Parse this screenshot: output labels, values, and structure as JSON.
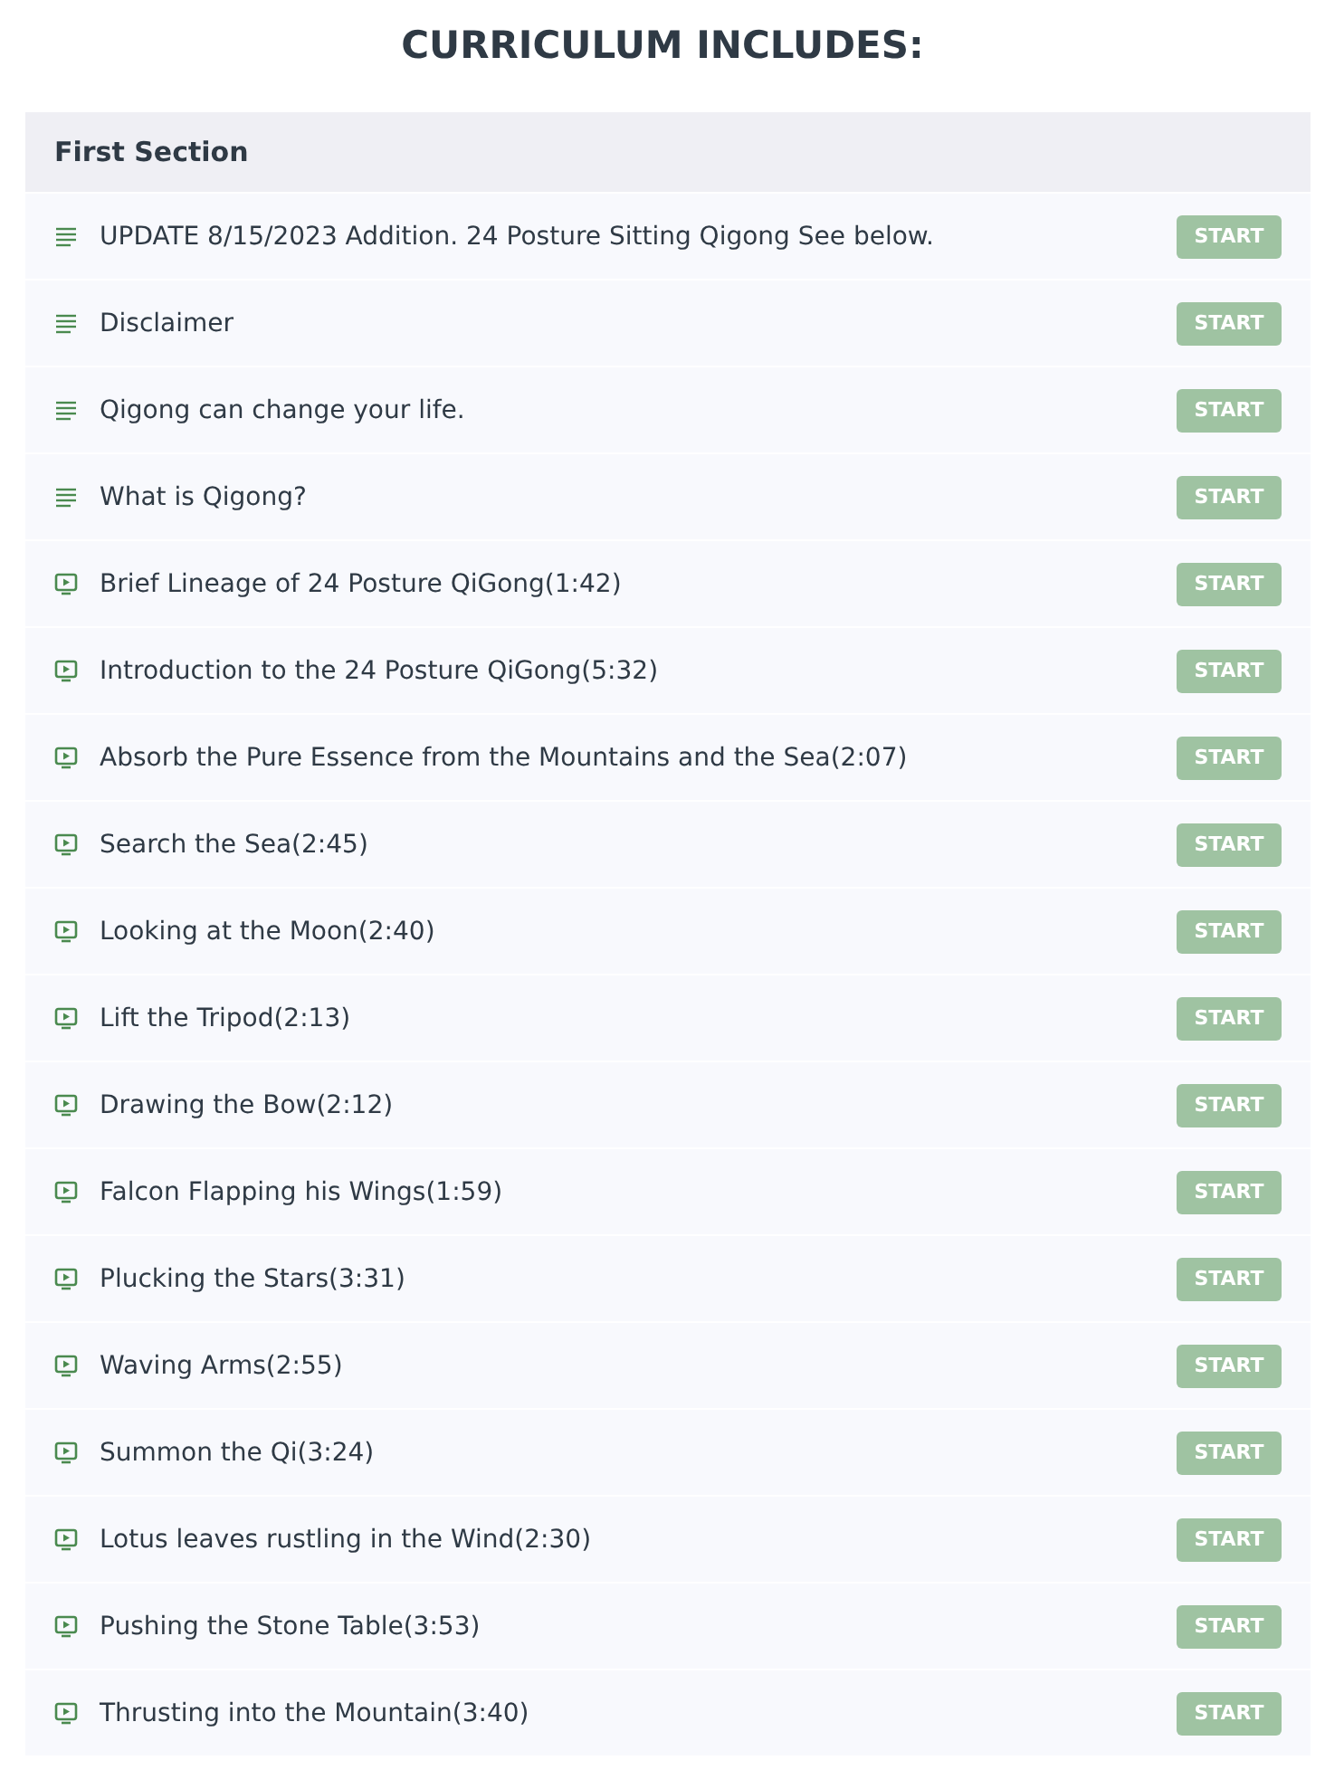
{
  "title": "CURRICULUM INCLUDES:",
  "section": {
    "title": "First Section",
    "lectures": [
      {
        "kind": "text",
        "label": "UPDATE 8/15/2023 Addition. 24 Posture Sitting Qigong See below.",
        "button": "START"
      },
      {
        "kind": "text",
        "label": "Disclaimer",
        "button": "START"
      },
      {
        "kind": "text",
        "label": "Qigong can change your life.",
        "button": "START"
      },
      {
        "kind": "text",
        "label": "What is Qigong?",
        "button": "START"
      },
      {
        "kind": "video",
        "label": "Brief Lineage of 24 Posture QiGong(1:42)",
        "button": "START"
      },
      {
        "kind": "video",
        "label": "Introduction to the 24 Posture QiGong(5:32)",
        "button": "START"
      },
      {
        "kind": "video",
        "label": "Absorb the Pure Essence from the Mountains and the Sea(2:07)",
        "button": "START"
      },
      {
        "kind": "video",
        "label": "Search the Sea(2:45)",
        "button": "START"
      },
      {
        "kind": "video",
        "label": "Looking at the Moon(2:40)",
        "button": "START"
      },
      {
        "kind": "video",
        "label": "Lift the Tripod(2:13)",
        "button": "START"
      },
      {
        "kind": "video",
        "label": "Drawing the Bow(2:12)",
        "button": "START"
      },
      {
        "kind": "video",
        "label": "Falcon Flapping his Wings(1:59)",
        "button": "START"
      },
      {
        "kind": "video",
        "label": "Plucking the Stars(3:31)",
        "button": "START"
      },
      {
        "kind": "video",
        "label": "Waving Arms(2:55)",
        "button": "START"
      },
      {
        "kind": "video",
        "label": "Summon the Qi(3:24)",
        "button": "START"
      },
      {
        "kind": "video",
        "label": "Lotus leaves rustling in the Wind(2:30)",
        "button": "START"
      },
      {
        "kind": "video",
        "label": "Pushing the Stone Table(3:53)",
        "button": "START"
      },
      {
        "kind": "video",
        "label": "Thrusting into the Mountain(3:40)",
        "button": "START"
      }
    ]
  }
}
